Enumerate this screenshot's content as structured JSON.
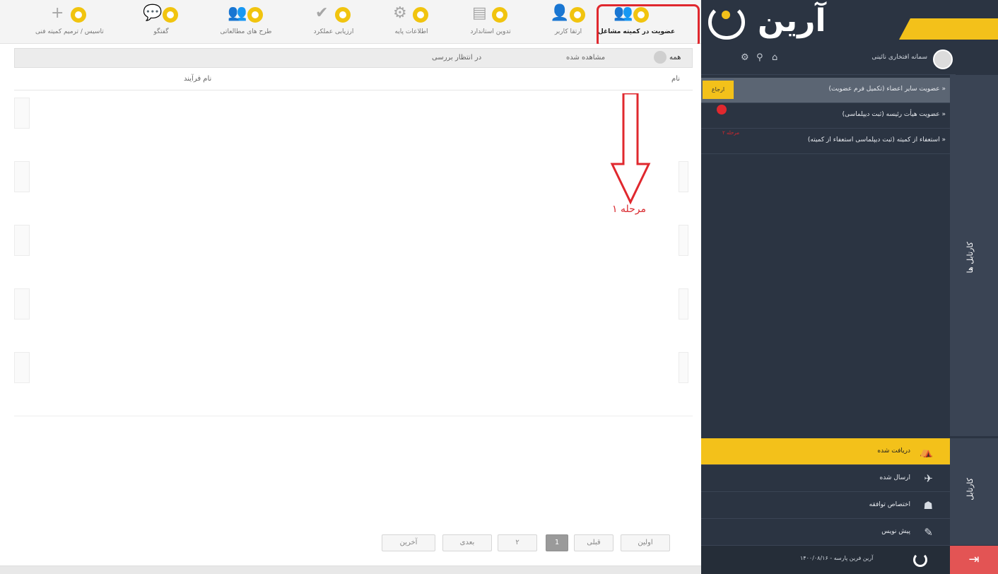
{
  "toolbar": {
    "items": [
      {
        "label": "عضویت در کمیته مشاغل",
        "icon": "users-group-icon",
        "glyph": "👥"
      },
      {
        "label": "ارتقا کاربر",
        "icon": "user-plus-icon",
        "glyph": "👤"
      },
      {
        "label": "تدوین استاندارد",
        "icon": "document-chart-icon",
        "glyph": "▤"
      },
      {
        "label": "اطلاعات پایه",
        "icon": "gears-icon",
        "glyph": "⚙"
      },
      {
        "label": "ارزیابی عملکرد",
        "icon": "checkmark-icon",
        "glyph": "✔"
      },
      {
        "label": "طرح های مطالعاتی",
        "icon": "team-icon",
        "glyph": "👥"
      },
      {
        "label": "گفتگو",
        "icon": "chat-bubble-icon",
        "glyph": "💬"
      },
      {
        "label": "تاسیس / ترمیم کمیته فنی",
        "icon": "plus-icon",
        "glyph": "+"
      }
    ],
    "badge_color": "#f1c40f",
    "highlight_color": "#e0282e"
  },
  "main": {
    "tabs": [
      {
        "label": "همه"
      },
      {
        "label": "مشاهده شده"
      },
      {
        "label": "در انتظار بررسی"
      }
    ],
    "columns": {
      "title": "نام",
      "process": "نام فرآیند"
    },
    "step_label": "مرحله ۱",
    "pagination": {
      "first": "اولین",
      "prev": "قبلی",
      "current": "1",
      "page2": "۲",
      "next": "بعدی",
      "last": "آخرین"
    }
  },
  "sidebar": {
    "brand_name": "آرین",
    "brand_color": "#f3c11a",
    "user_name": "سمانه افتخاری نائینی",
    "messages": [
      {
        "text": "« عضویت سایر اعضاء (تکمیل فرم عضویت)",
        "flag": "ارجاع"
      },
      {
        "text": "« عضویت هیأت رئیسه (ثبت دیپلماسی)"
      },
      {
        "text": "« استعفاء از کمیته (ثبت دیپلماسی استعفاء از کمیته)"
      }
    ],
    "small_note": "مرحله ۲",
    "vtab_messages": "کارتابل ها",
    "vtab_folders": "کارتابل",
    "folders": [
      {
        "label": "دریافت شده",
        "icon": "inbox-tray-icon",
        "glyph": "⛺"
      },
      {
        "label": "ارسال شده",
        "icon": "paper-plane-icon",
        "glyph": "✈"
      },
      {
        "label": "اختصاص توافقه",
        "icon": "assign-users-icon",
        "glyph": "☗"
      },
      {
        "label": "پیش نویس",
        "icon": "pencil-icon",
        "glyph": "✎"
      }
    ],
    "footer_text": "آرین فرین پارسه - ۱۴۰۰/۰۸/۱۶",
    "logout_glyph": "⇥"
  }
}
